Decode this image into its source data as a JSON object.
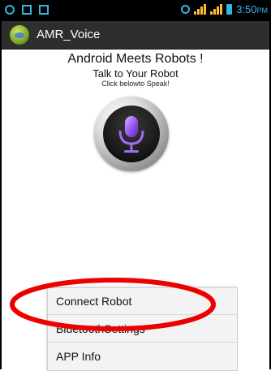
{
  "status_bar": {
    "time": "3:50",
    "time_suffix": "PM",
    "accent_color": "#33b5e5",
    "icons": [
      "sync-icon",
      "image-icon",
      "sd-card-icon",
      "alarm-icon",
      "signal-icon",
      "signal-icon",
      "battery-icon"
    ]
  },
  "action_bar": {
    "title": "AMR_Voice",
    "logo_icon": "app-logo-icon"
  },
  "main": {
    "headline": "Android Meets Robots !",
    "subheadline": "Talk to Your Robot",
    "hint": "Click belowto Speak!",
    "mic_icon": "microphone-icon"
  },
  "menu": {
    "items": [
      {
        "label": "Connect Robot"
      },
      {
        "label": "BluetoothSettings"
      },
      {
        "label": "APP Info"
      }
    ]
  },
  "annotation": {
    "color": "#ee0000",
    "target": "Connect Robot"
  }
}
